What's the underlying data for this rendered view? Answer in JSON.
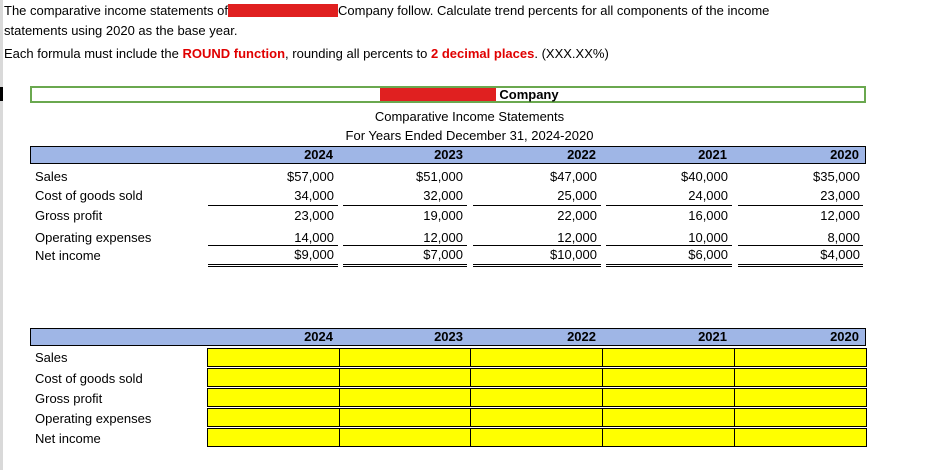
{
  "instructions": {
    "line1_prefix": "The comparative income statements of",
    "line1_suffix": "Company follow.  Calculate trend percents for all components of the income",
    "line2": "statements using 2020 as the base year.",
    "line3_prefix": "Each formula must include the ",
    "line3_round": "ROUND function",
    "line3_mid": ", rounding all percents to ",
    "line3_decimals": "2 decimal places",
    "line3_suffix": ". (XXX.XX%)"
  },
  "statement": {
    "company_suffix": "Company",
    "title": "Comparative Income Statements",
    "period": "For Years Ended December 31, 2024-2020",
    "years": [
      "2024",
      "2023",
      "2022",
      "2021",
      "2020"
    ],
    "rows": [
      {
        "label": "Sales",
        "values": [
          "$57,000",
          "$51,000",
          "$47,000",
          "$40,000",
          "$35,000"
        ]
      },
      {
        "label": "Cost of goods sold",
        "values": [
          "34,000",
          "32,000",
          "25,000",
          "24,000",
          "23,000"
        ]
      },
      {
        "label": "Gross profit",
        "values": [
          "23,000",
          "19,000",
          "22,000",
          "16,000",
          "12,000"
        ]
      },
      {
        "label": "Operating expenses",
        "values": [
          "14,000",
          "12,000",
          "12,000",
          "10,000",
          "8,000"
        ]
      },
      {
        "label": "Net income",
        "values": [
          "$9,000",
          "$7,000",
          "$10,000",
          "$6,000",
          "$4,000"
        ]
      }
    ]
  },
  "trend_table": {
    "years": [
      "2024",
      "2023",
      "2022",
      "2021",
      "2020"
    ],
    "rows": [
      "Sales",
      "Cost of goods sold",
      "Gross profit",
      "Operating expenses",
      "Net income"
    ]
  },
  "colors": {
    "header_band": "#9fb6e6",
    "input_cell": "#ffff00",
    "emphasis_text": "#e00000",
    "active_cell_border": "#6aa84f"
  }
}
